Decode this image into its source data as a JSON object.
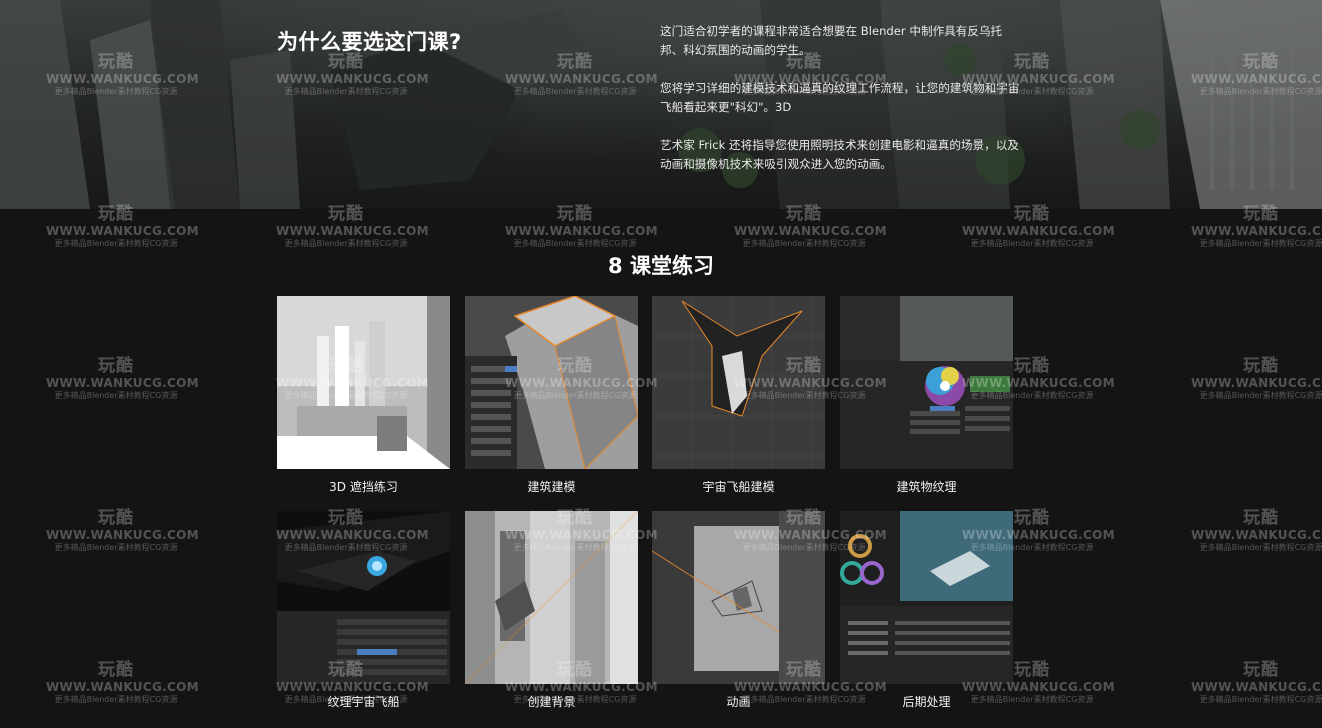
{
  "hero": {
    "title": "为什么要选这门课?",
    "paragraphs": [
      "这门适合初学者的课程非常适合想要在 Blender 中制作具有反乌托邦、科幻氛围的动画的学生。",
      "您将学习详细的建模技术和逼真的纹理工作流程，让您的建筑物和宇宙飞船看起来更\"科幻\"。3D",
      "艺术家 Frick 还将指导您使用照明技术来创建电影和逼真的场景，以及动画和摄像机技术来吸引观众进入您的动画。"
    ]
  },
  "exercises": {
    "title": "8 课堂练习",
    "items": [
      {
        "label": "3D 遮挡练习"
      },
      {
        "label": "建筑建模"
      },
      {
        "label": "宇宙飞船建模"
      },
      {
        "label": "建筑物纹理"
      },
      {
        "label": "纹理宇宙飞船"
      },
      {
        "label": "创建背景"
      },
      {
        "label": "动画"
      },
      {
        "label": "后期处理"
      }
    ]
  },
  "watermark": {
    "logo": "玩酷",
    "site": "WWW.WANKUCG.COM",
    "tagline": "更多精品Blender素材教程CG资源"
  },
  "colors": {
    "page_bg": "#141414",
    "accent_orange": "#e8892b"
  }
}
